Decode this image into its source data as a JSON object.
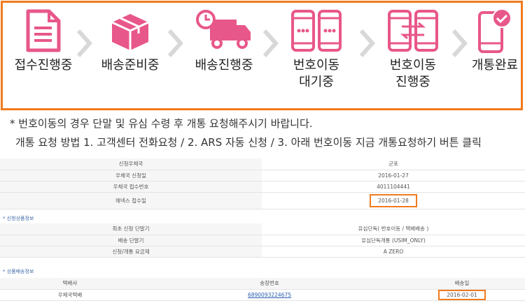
{
  "steps": [
    {
      "label": "접수진행중",
      "icon": "document-icon"
    },
    {
      "label": "배송준비중",
      "icon": "box-icon"
    },
    {
      "label": "배송진행중",
      "icon": "truck-icon"
    },
    {
      "label": "번호이동\n대기중",
      "icon": "two-phones-icon"
    },
    {
      "label": "번호이동\n진행중",
      "icon": "phones-transfer-icon"
    },
    {
      "label": "개통완료",
      "icon": "phone-check-icon"
    }
  ],
  "notes": {
    "line1": "* 번호이동의 경우 단말 및 유심 수령 후 개통 요청해주시기 바랍니다.",
    "line2": "개통 요청 방법 1. 고객센터 전화요청 / 2. ARS 자동 신청 / 3. 아래 번호이동 지금 개통요청하기 버튼 클릭"
  },
  "order_info": [
    {
      "key": "신청우체국",
      "value": "군포"
    },
    {
      "key": "우체국 신청일",
      "value": "2016-01-27"
    },
    {
      "key": "우체국 접수번호",
      "value": "4011104441"
    },
    {
      "key": "에넥스 접수일",
      "value": "2016-01-28"
    }
  ],
  "product_section": {
    "title": "신청상품정보"
  },
  "product_info": [
    {
      "key": "최초 신청 단말기",
      "value": "유심단독( 번호이동 / 택배배송 )"
    },
    {
      "key": "배송 단말기",
      "value": "유심단독개통 (USIM_ONLY)"
    },
    {
      "key": "신청/개통 요금제",
      "value": "A ZERO"
    }
  ],
  "shipping_section": {
    "title": "상품배송정보"
  },
  "shipping": {
    "headers": [
      "택배사",
      "송장번호",
      "배송일"
    ],
    "row": [
      "우체국택배",
      "6890093224675",
      "2016-02-01"
    ]
  },
  "colors": {
    "accent": "#f07b1f",
    "icon": "#e8578a",
    "chevron": "#d8d8d8"
  }
}
